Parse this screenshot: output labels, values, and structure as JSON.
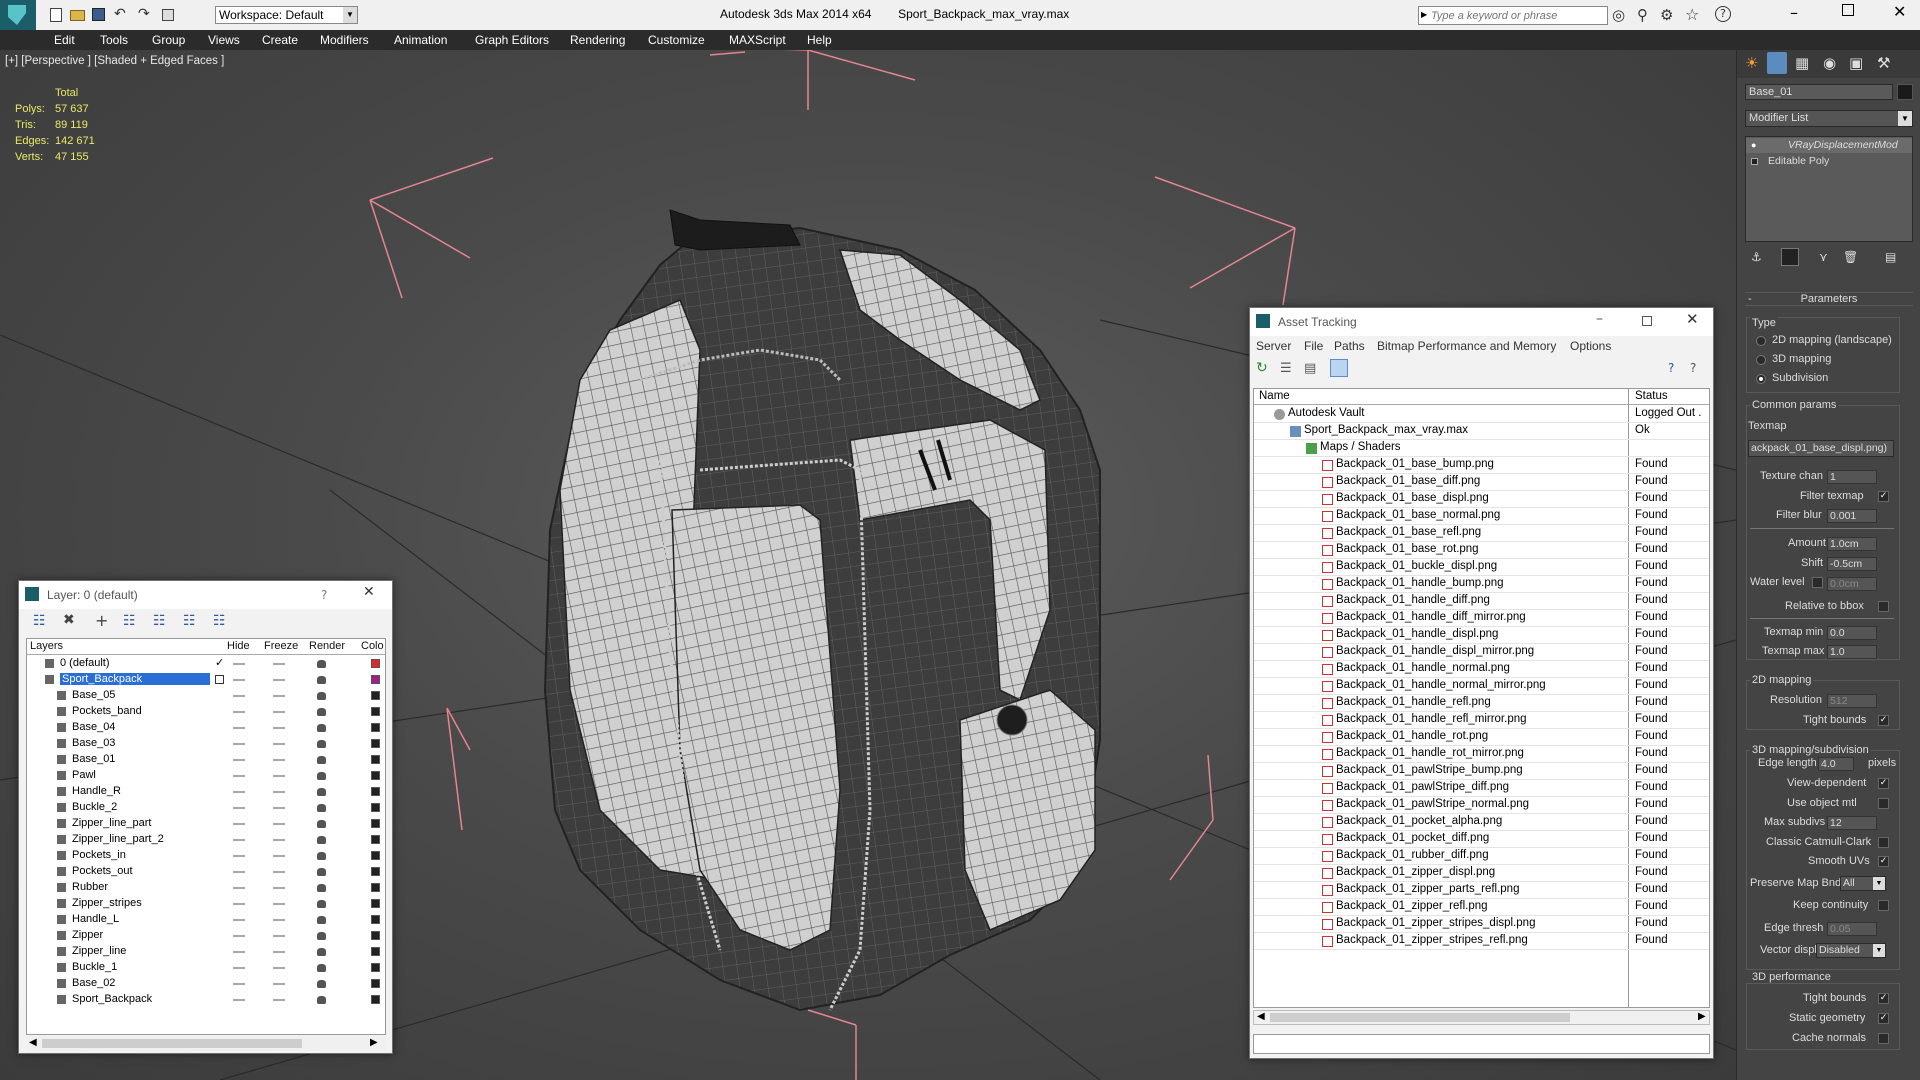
{
  "app": {
    "title": "Autodesk 3ds Max  2014 x64",
    "file": "Sport_Backpack_max_vray.max",
    "workspace": "Workspace: Default",
    "search_placeholder": "Type a keyword or phrase"
  },
  "menu": [
    "Edit",
    "Tools",
    "Group",
    "Views",
    "Create",
    "Modifiers",
    "Animation",
    "Graph Editors",
    "Rendering",
    "Customize",
    "MAXScript",
    "Help"
  ],
  "viewport": {
    "label": "[+] [Perspective ] [Shaded + Edged Faces ]",
    "stats_header": "Total",
    "stats": [
      {
        "label": "Polys:",
        "value": "57 637"
      },
      {
        "label": "Tris:",
        "value": "89 119"
      },
      {
        "label": "Edges:",
        "value": "142 671"
      },
      {
        "label": "Verts:",
        "value": "47 155"
      }
    ]
  },
  "command_panel": {
    "object_name": "Base_01",
    "modifier_list": "Modifier List",
    "stack": [
      {
        "label": "VRayDisplacementMod"
      },
      {
        "label": "Editable Poly"
      }
    ],
    "rollout_title": "Parameters",
    "type_label": "Type",
    "type_options": [
      {
        "label": "2D mapping (landscape)",
        "selected": false
      },
      {
        "label": "3D mapping",
        "selected": false
      },
      {
        "label": "Subdivision",
        "selected": true
      }
    ],
    "common_label": "Common params",
    "texmap_label": "Texmap",
    "texmap_value": "ackpack_01_base_displ.png)",
    "texture_chan_label": "Texture chan",
    "texture_chan": "1",
    "filter_texmap_label": "Filter texmap",
    "filter_blur_label": "Filter blur",
    "filter_blur": "0.001",
    "amount_label": "Amount",
    "amount": "1.0cm",
    "shift_label": "Shift",
    "shift": "-0.5cm",
    "water_label": "Water level",
    "water": "0.0cm",
    "relative_label": "Relative to bbox",
    "texmap_min_label": "Texmap min",
    "texmap_min": "0.0",
    "texmap_max_label": "Texmap max",
    "texmap_max": "1.0",
    "mapping2d_label": "2D mapping",
    "resolution_label": "Resolution",
    "resolution": "512",
    "tight_bounds_label": "Tight bounds",
    "mapping3d_label": "3D mapping/subdivision",
    "edge_length_label": "Edge length",
    "edge_length": "4.0",
    "pixels_label": "pixels",
    "view_dependent_label": "View-dependent",
    "use_object_mtl_label": "Use object mtl",
    "max_subdivs_label": "Max subdivs",
    "max_subdivs": "12",
    "catmull_label": "Classic Catmull-Clark",
    "smooth_uvs_label": "Smooth UVs",
    "preserve_label": "Preserve Map Bnd",
    "preserve_value": "All",
    "keep_continuity_label": "Keep continuity",
    "edge_thresh_label": "Edge thresh",
    "edge_thresh": "0.05",
    "vector_displ_label": "Vector displ",
    "vector_displ": "Disabled",
    "perf_label": "3D performance",
    "perf_tight_label": "Tight bounds",
    "static_geometry_label": "Static geometry",
    "cache_normals_label": "Cache normals"
  },
  "asset_tracking": {
    "title": "Asset Tracking",
    "menu": [
      "Server",
      "File",
      "Paths",
      "Bitmap Performance and Memory",
      "Options"
    ],
    "col_name": "Name",
    "col_status": "Status",
    "vault": {
      "name": "Autodesk Vault",
      "status": "Logged Out ."
    },
    "file": {
      "name": "Sport_Backpack_max_vray.max",
      "status": "Ok"
    },
    "folder": {
      "name": "Maps / Shaders",
      "status": ""
    },
    "maps": [
      "Backpack_01_base_bump.png",
      "Backpack_01_base_diff.png",
      "Backpack_01_base_displ.png",
      "Backpack_01_base_normal.png",
      "Backpack_01_base_refl.png",
      "Backpack_01_base_rot.png",
      "Backpack_01_buckle_displ.png",
      "Backpack_01_handle_bump.png",
      "Backpack_01_handle_diff.png",
      "Backpack_01_handle_diff_mirror.png",
      "Backpack_01_handle_displ.png",
      "Backpack_01_handle_displ_mirror.png",
      "Backpack_01_handle_normal.png",
      "Backpack_01_handle_normal_mirror.png",
      "Backpack_01_handle_refl.png",
      "Backpack_01_handle_refl_mirror.png",
      "Backpack_01_handle_rot.png",
      "Backpack_01_handle_rot_mirror.png",
      "Backpack_01_pawlStripe_bump.png",
      "Backpack_01_pawlStripe_diff.png",
      "Backpack_01_pawlStripe_normal.png",
      "Backpack_01_pocket_alpha.png",
      "Backpack_01_pocket_diff.png",
      "Backpack_01_rubber_diff.png",
      "Backpack_01_zipper_displ.png",
      "Backpack_01_zipper_parts_refl.png",
      "Backpack_01_zipper_refl.png",
      "Backpack_01_zipper_stripes_displ.png",
      "Backpack_01_zipper_stripes_refl.png"
    ],
    "found": "Found"
  },
  "layer_window": {
    "title": "Layer: 0 (default)",
    "help": "?",
    "cols": {
      "layers": "Layers",
      "hide": "Hide",
      "freeze": "Freeze",
      "render": "Render",
      "color": "Colo"
    },
    "rows": [
      "0 (default)",
      "Sport_Backpack",
      "Base_05",
      "Pockets_band",
      "Base_04",
      "Base_03",
      "Base_01",
      "Pawl",
      "Handle_R",
      "Buckle_2",
      "Zipper_line_part",
      "Zipper_line_part_2",
      "Pockets_in",
      "Pockets_out",
      "Rubber",
      "Zipper_stripes",
      "Handle_L",
      "Zipper",
      "Zipper_line",
      "Buckle_1",
      "Base_02",
      "Sport_Backpack"
    ]
  }
}
